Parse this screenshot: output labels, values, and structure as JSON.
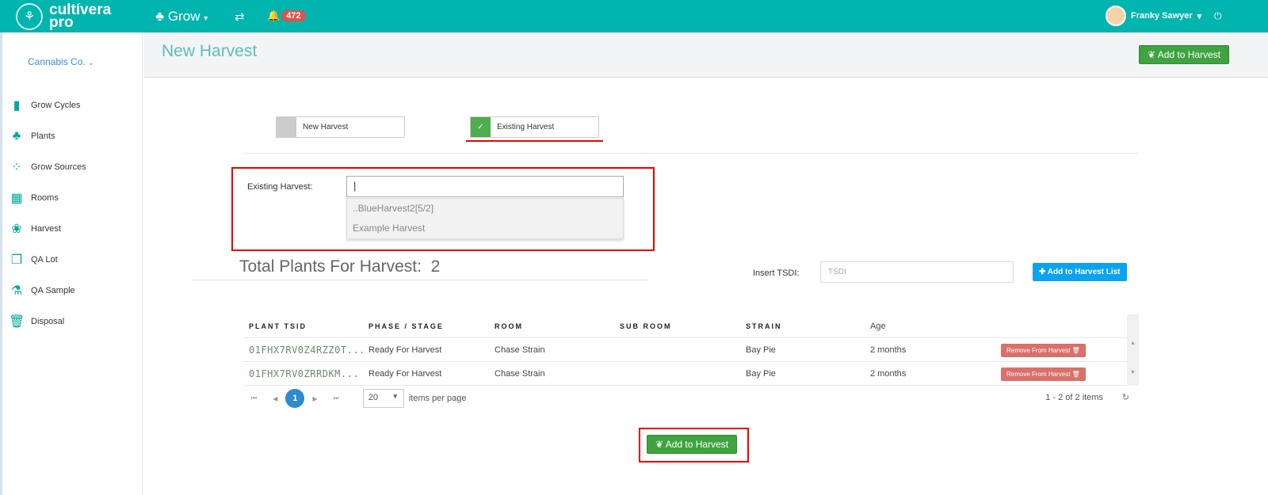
{
  "topbar": {
    "logo_line1": "cultívera",
    "logo_line2": "pro",
    "module": "Grow",
    "notifications": "472",
    "user": "Franky Sawyer"
  },
  "sidebar": {
    "company": "Cannabis Co.",
    "items": [
      {
        "label": "Grow Cycles",
        "icon": "▮"
      },
      {
        "label": "Plants",
        "icon": "♣"
      },
      {
        "label": "Grow Sources",
        "icon": "⁘"
      },
      {
        "label": "Rooms",
        "icon": "▦"
      },
      {
        "label": "Harvest",
        "icon": "❀"
      },
      {
        "label": "QA Lot",
        "icon": "❐"
      },
      {
        "label": "QA Sample",
        "icon": "⚗"
      },
      {
        "label": "Disposal",
        "icon": "🗑"
      }
    ]
  },
  "header": {
    "title": "New Harvest",
    "add_button": "Add to Harvest"
  },
  "toggles": {
    "new": "New Harvest",
    "existing": "Existing Harvest"
  },
  "existing": {
    "label": "Existing Harvest:",
    "value": "",
    "options": [
      "..BlueHarvest2[5/2]",
      "Example Harvest"
    ]
  },
  "total": {
    "label": "Total Plants For Harvest:",
    "value": "2"
  },
  "tsdi": {
    "label": "Insert TSDI:",
    "placeholder": "TSDI",
    "button": "Add to Harvest List"
  },
  "grid": {
    "columns": [
      "PLANT TSID",
      "PHASE / STAGE",
      "ROOM",
      "SUB ROOM",
      "STRAIN",
      "Age"
    ],
    "rows": [
      {
        "tsid": "01FHX7RV0Z4RZZ0T...",
        "phase": "Ready For Harvest",
        "room": "Chase Strain",
        "subroom": "",
        "strain": "Bay Pie",
        "age": "2 months",
        "action": "Remove From Harvest 🗑"
      },
      {
        "tsid": "01FHX7RV0ZRRDKM...",
        "phase": "Ready For Harvest",
        "room": "Chase Strain",
        "subroom": "",
        "strain": "Bay Pie",
        "age": "2 months",
        "action": "Remove From Harvest 🗑"
      }
    ]
  },
  "pager": {
    "page": "1",
    "page_size": "20",
    "per_page_label": "items per page",
    "summary": "1 - 2 of 2 items"
  },
  "footer": {
    "add_button": "Add to Harvest"
  }
}
